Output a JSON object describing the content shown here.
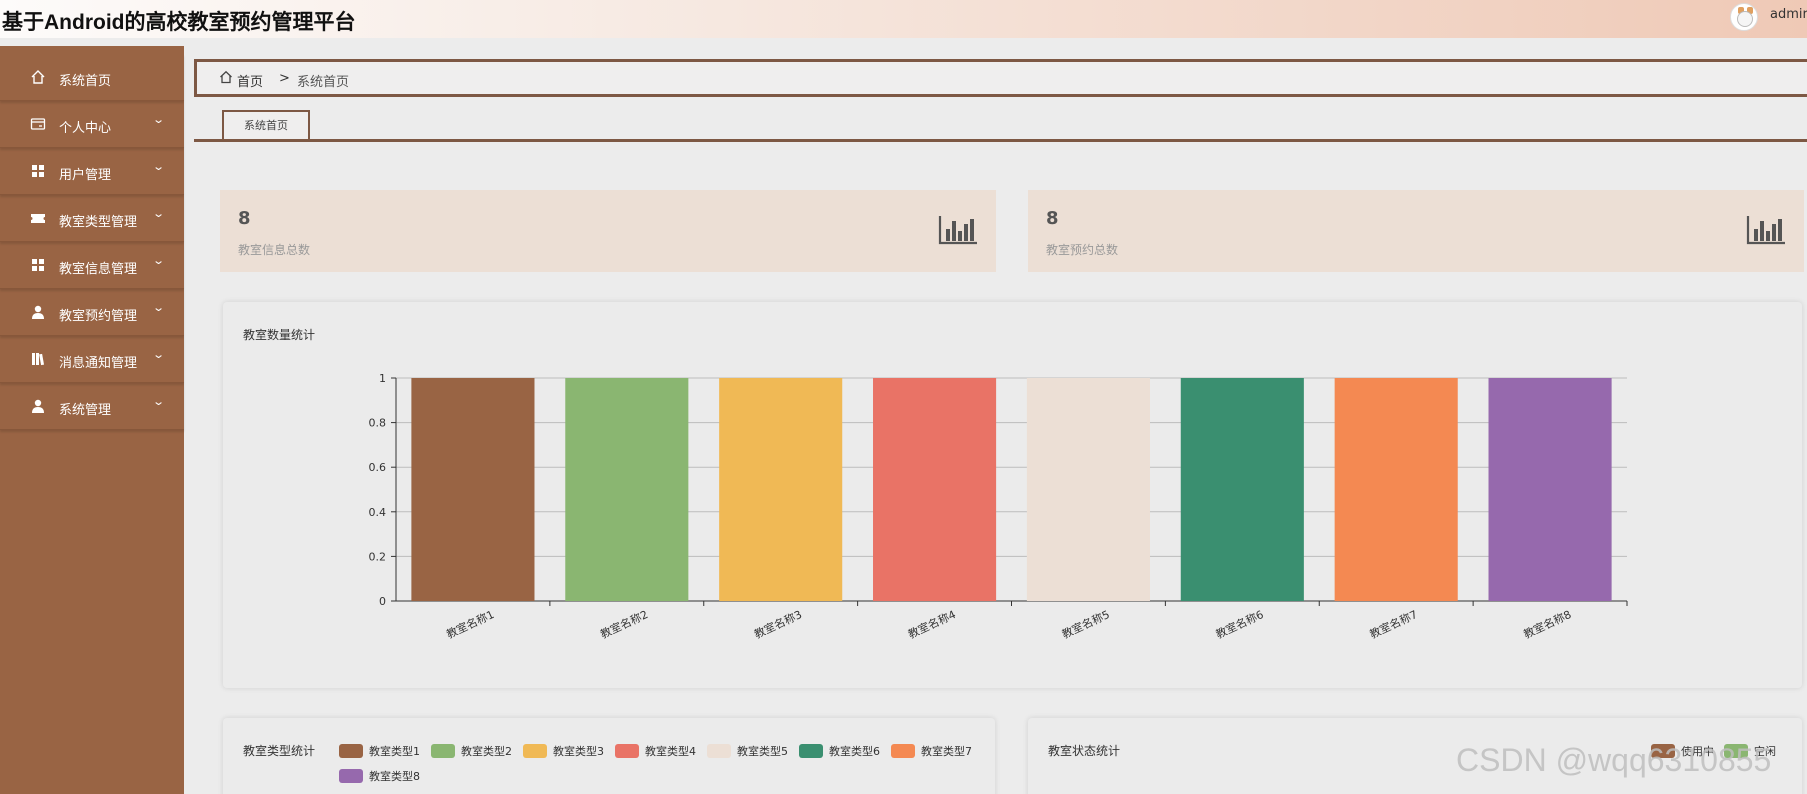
{
  "header": {
    "title": "基于Android的高校教室预约管理平台",
    "username": "admir"
  },
  "sidebar": {
    "items": [
      {
        "label": "系统首页",
        "icon": "home-icon",
        "has_children": false
      },
      {
        "label": "个人中心",
        "icon": "card-icon",
        "has_children": true
      },
      {
        "label": "用户管理",
        "icon": "grid-icon",
        "has_children": true
      },
      {
        "label": "教室类型管理",
        "icon": "ticket-icon",
        "has_children": true
      },
      {
        "label": "教室信息管理",
        "icon": "grid-icon",
        "has_children": true
      },
      {
        "label": "教室预约管理",
        "icon": "user-icon",
        "has_children": true
      },
      {
        "label": "消息通知管理",
        "icon": "books-icon",
        "has_children": true
      },
      {
        "label": "系统管理",
        "icon": "user-icon",
        "has_children": true
      }
    ]
  },
  "breadcrumb": {
    "home": "首页",
    "separator": ">",
    "current": "系统首页"
  },
  "tabs": [
    {
      "label": "系统首页"
    }
  ],
  "stats": [
    {
      "value": "8",
      "label": "教室信息总数"
    },
    {
      "value": "8",
      "label": "教室预约总数"
    }
  ],
  "panels": {
    "room_count": {
      "title": "教室数量统计"
    },
    "room_type": {
      "title": "教室类型统计",
      "legend": [
        {
          "name": "教室类型1",
          "color": "#996444"
        },
        {
          "name": "教室类型2",
          "color": "#8ab671"
        },
        {
          "name": "教室类型3",
          "color": "#f0b955"
        },
        {
          "name": "教室类型4",
          "color": "#e97366"
        },
        {
          "name": "教室类型5",
          "color": "#ecdfd5"
        },
        {
          "name": "教室类型6",
          "color": "#3a8f70"
        },
        {
          "name": "教室类型7",
          "color": "#f48952"
        },
        {
          "name": "教室类型8",
          "color": "#9669ad"
        }
      ]
    },
    "room_status": {
      "title": "教室状态统计",
      "legend": [
        {
          "name": "使用中",
          "color": "#996444"
        },
        {
          "name": "空闲",
          "color": "#8ab671"
        }
      ]
    }
  },
  "chart_data": {
    "type": "bar",
    "title": "教室数量统计",
    "categories": [
      "教室名称1",
      "教室名称2",
      "教室名称3",
      "教室名称4",
      "教室名称5",
      "教室名称6",
      "教室名称7",
      "教室名称8"
    ],
    "values": [
      1,
      1,
      1,
      1,
      1,
      1,
      1,
      1
    ],
    "colors": [
      "#996444",
      "#8ab671",
      "#f0b955",
      "#e97366",
      "#ecdfd5",
      "#3a8f70",
      "#f48952",
      "#9669ad"
    ],
    "ylim": [
      0,
      1
    ],
    "yticks": [
      "0",
      "0.2",
      "0.4",
      "0.6",
      "0.8",
      "1"
    ],
    "grid": true,
    "xlabel": "",
    "ylabel": ""
  },
  "watermark": "CSDN @wqq6310855"
}
